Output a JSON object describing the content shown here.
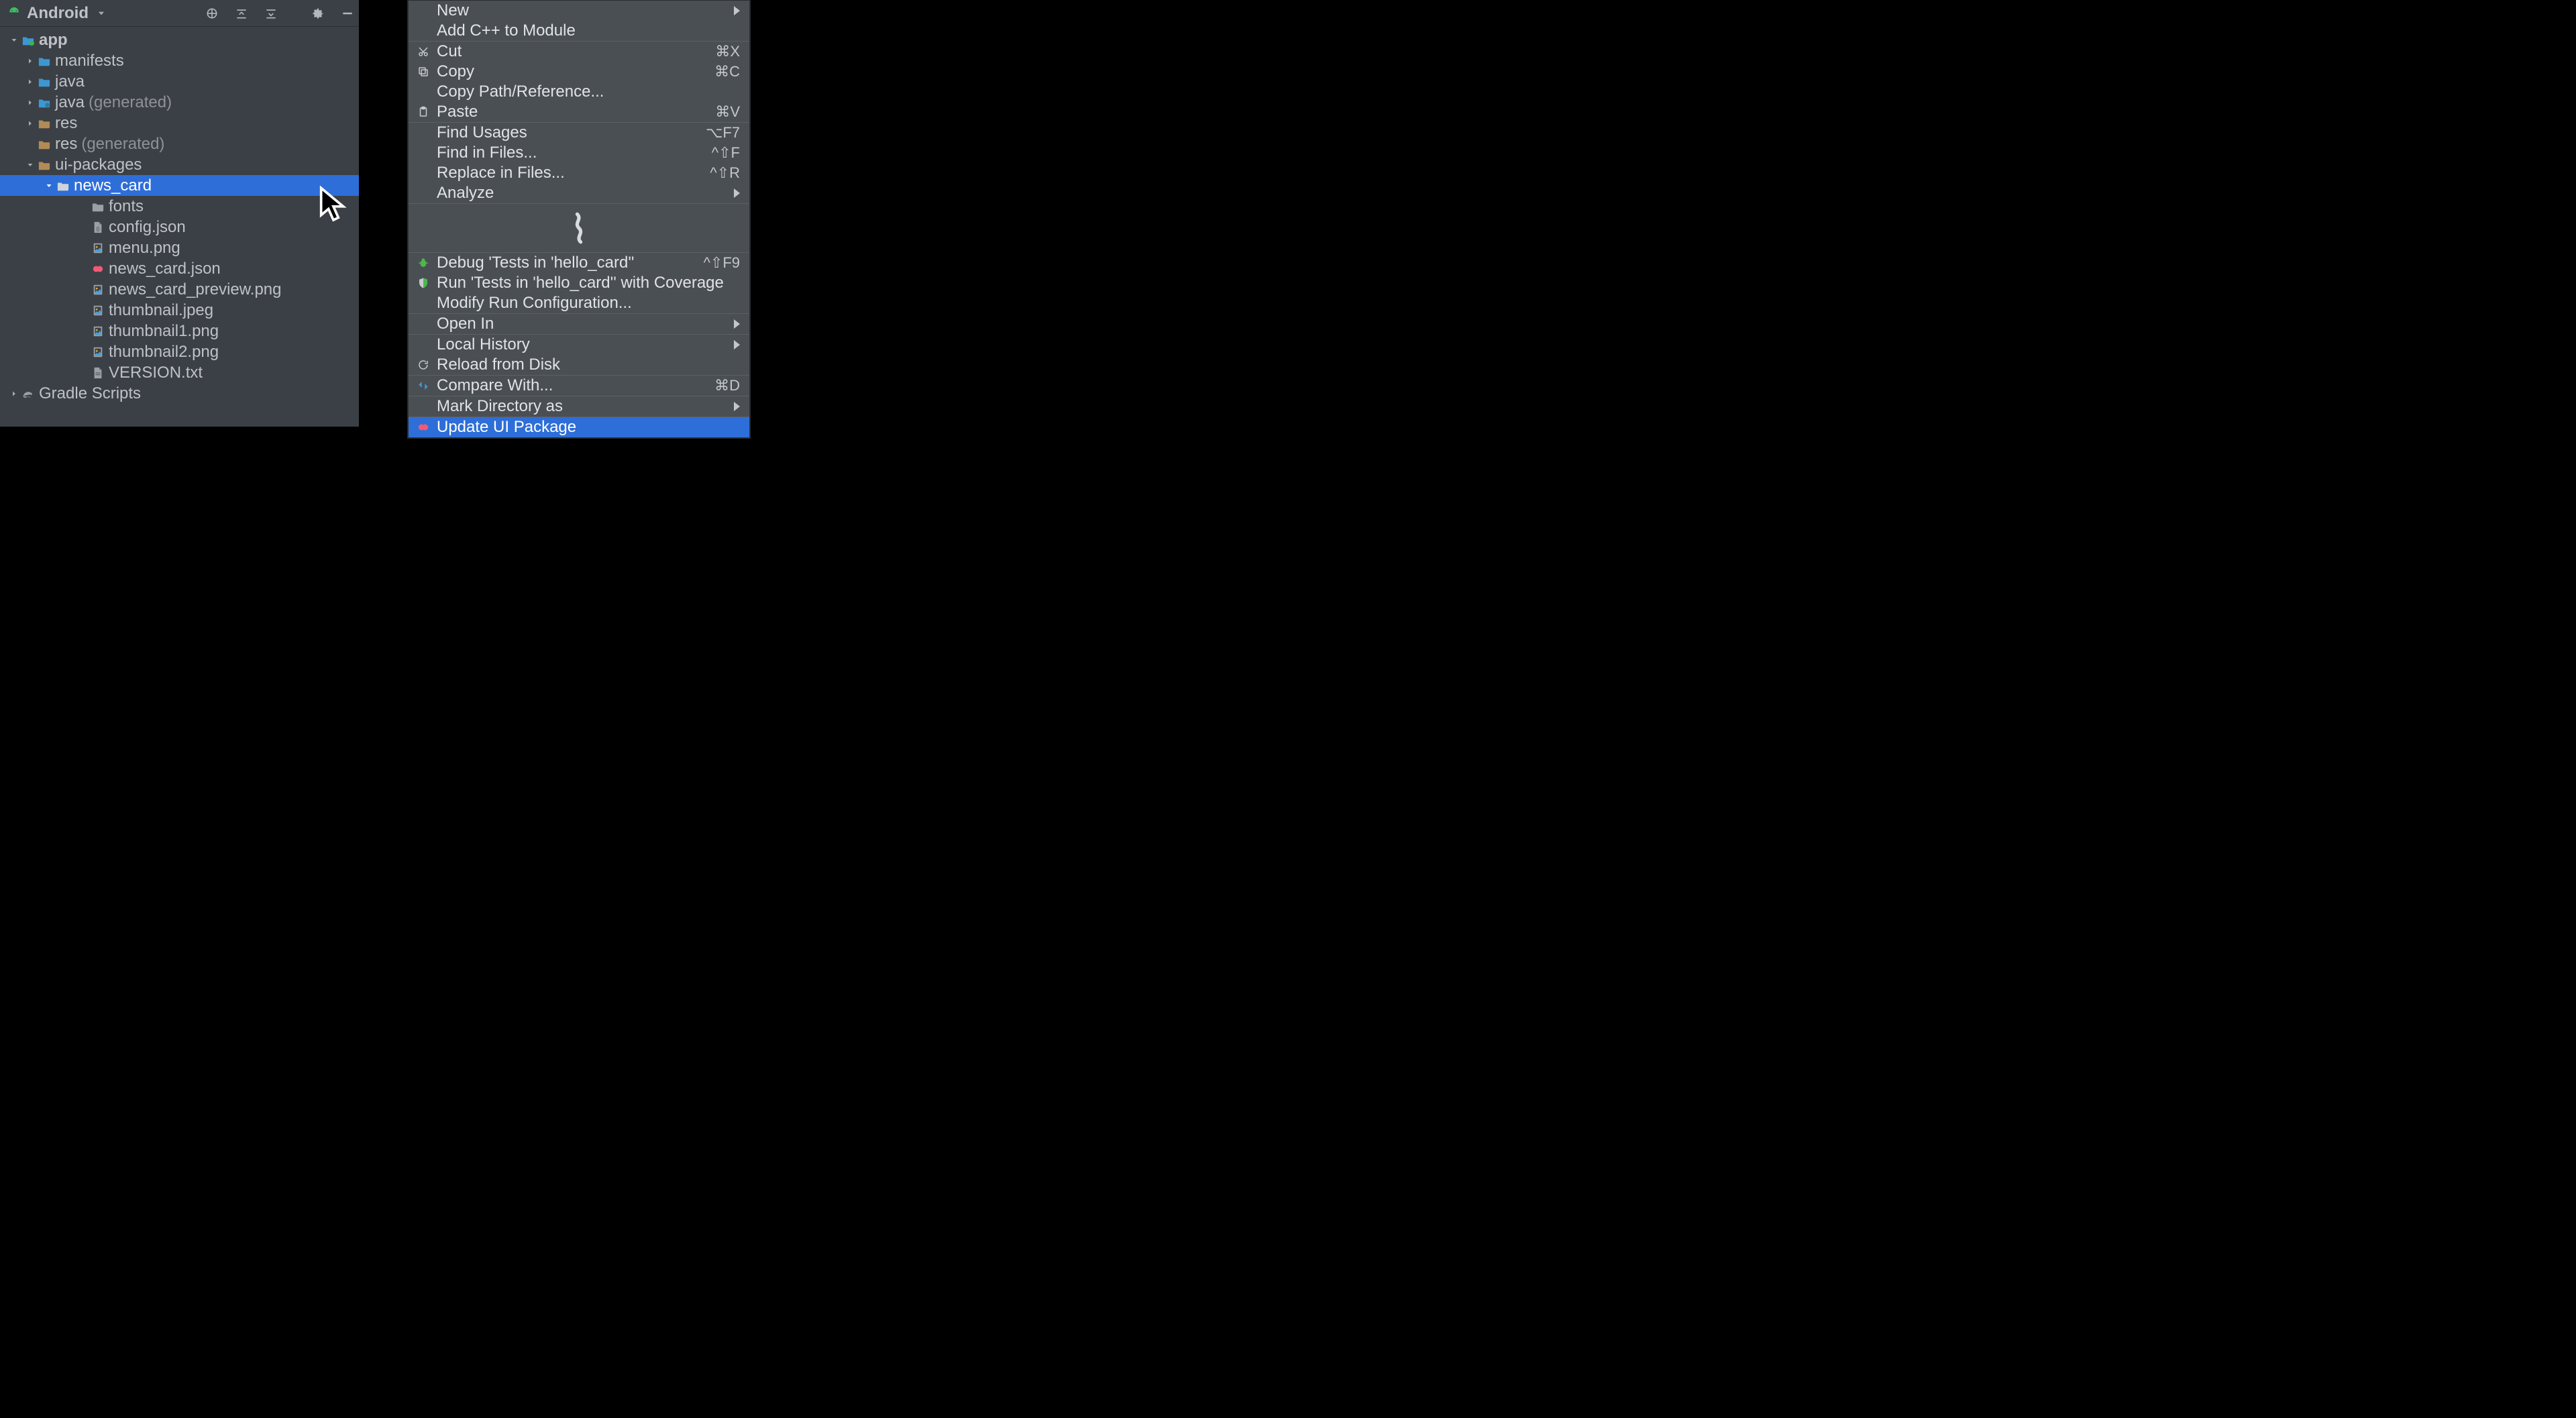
{
  "project": {
    "view_label": "Android",
    "tree": [
      {
        "id": "app",
        "label": "app",
        "kind": "module",
        "indent": 14,
        "caret": "down",
        "bold": true,
        "selected": false
      },
      {
        "id": "manifests",
        "label": "manifests",
        "kind": "folder",
        "indent": 38,
        "caret": "right",
        "bold": false,
        "selected": false
      },
      {
        "id": "java",
        "label": "java",
        "kind": "folder",
        "indent": 38,
        "caret": "right",
        "bold": false,
        "selected": false
      },
      {
        "id": "java-gen",
        "label": "java",
        "suffix": "(generated)",
        "kind": "folder-gen",
        "indent": 38,
        "caret": "right",
        "bold": false,
        "selected": false
      },
      {
        "id": "res",
        "label": "res",
        "kind": "folder-res",
        "indent": 38,
        "caret": "right",
        "bold": false,
        "selected": false
      },
      {
        "id": "res-gen",
        "label": "res",
        "suffix": "(generated)",
        "kind": "folder-res",
        "indent": 38,
        "caret": "blank",
        "bold": false,
        "selected": false
      },
      {
        "id": "ui-packages",
        "label": "ui-packages",
        "kind": "folder-res",
        "indent": 38,
        "caret": "down",
        "bold": false,
        "selected": false
      },
      {
        "id": "news_card",
        "label": "news_card",
        "kind": "folder-plain",
        "indent": 66,
        "caret": "down",
        "bold": false,
        "selected": true
      },
      {
        "id": "fonts",
        "label": "fonts",
        "kind": "folder-plain",
        "indent": 118,
        "caret": "blank",
        "bold": false,
        "selected": false
      },
      {
        "id": "config.json",
        "label": "config.json",
        "kind": "file-json",
        "indent": 118,
        "caret": "blank",
        "bold": false,
        "selected": false
      },
      {
        "id": "menu.png",
        "label": "menu.png",
        "kind": "file-image",
        "indent": 118,
        "caret": "blank",
        "bold": false,
        "selected": false
      },
      {
        "id": "news_card.json",
        "label": "news_card.json",
        "kind": "file-pink",
        "indent": 118,
        "caret": "blank",
        "bold": false,
        "selected": false
      },
      {
        "id": "newscard_prev",
        "label": "news_card_preview.png",
        "kind": "file-image",
        "indent": 118,
        "caret": "blank",
        "bold": false,
        "selected": false
      },
      {
        "id": "thumbnail.jpeg",
        "label": "thumbnail.jpeg",
        "kind": "file-image",
        "indent": 118,
        "caret": "blank",
        "bold": false,
        "selected": false
      },
      {
        "id": "thumbnail1.png",
        "label": "thumbnail1.png",
        "kind": "file-image",
        "indent": 118,
        "caret": "blank",
        "bold": false,
        "selected": false
      },
      {
        "id": "thumbnail2.png",
        "label": "thumbnail2.png",
        "kind": "file-image",
        "indent": 118,
        "caret": "blank",
        "bold": false,
        "selected": false
      },
      {
        "id": "VERSION.txt",
        "label": "VERSION.txt",
        "kind": "file-text",
        "indent": 118,
        "caret": "blank",
        "bold": false,
        "selected": false
      },
      {
        "id": "gradle",
        "label": "Gradle Scripts",
        "kind": "gradle",
        "indent": 14,
        "caret": "right",
        "bold": false,
        "selected": false
      }
    ]
  },
  "menu": {
    "items": [
      {
        "id": "new",
        "label": "New",
        "shortcut": "",
        "icon": "",
        "submenu": true,
        "highlight": false
      },
      {
        "id": "add-cpp",
        "label": "Add C++ to Module",
        "shortcut": "",
        "icon": "",
        "submenu": false,
        "highlight": false
      },
      {
        "sep": true
      },
      {
        "id": "cut",
        "label": "Cut",
        "shortcut": "⌘X",
        "icon": "cut",
        "submenu": false,
        "highlight": false
      },
      {
        "id": "copy",
        "label": "Copy",
        "shortcut": "⌘C",
        "icon": "copy",
        "submenu": false,
        "highlight": false
      },
      {
        "id": "copy-path",
        "label": "Copy Path/Reference...",
        "shortcut": "",
        "icon": "",
        "submenu": false,
        "highlight": false
      },
      {
        "id": "paste",
        "label": "Paste",
        "shortcut": "⌘V",
        "icon": "paste",
        "submenu": false,
        "highlight": false
      },
      {
        "sep": true
      },
      {
        "id": "find-usages",
        "label": "Find Usages",
        "shortcut": "⌥F7",
        "icon": "",
        "submenu": false,
        "highlight": false
      },
      {
        "id": "find-in-files",
        "label": "Find in Files...",
        "shortcut": "^⇧F",
        "icon": "",
        "submenu": false,
        "highlight": false
      },
      {
        "id": "replace-in-files",
        "label": "Replace in Files...",
        "shortcut": "^⇧R",
        "icon": "",
        "submenu": false,
        "highlight": false
      },
      {
        "id": "analyze",
        "label": "Analyze",
        "shortcut": "",
        "icon": "",
        "submenu": true,
        "highlight": false
      },
      {
        "sep": true
      },
      {
        "squiggle": true
      },
      {
        "sep": true
      },
      {
        "id": "debug-tests",
        "label": "Debug 'Tests in 'hello_card''",
        "shortcut": "^⇧F9",
        "icon": "bug",
        "submenu": false,
        "highlight": false
      },
      {
        "id": "run-coverage",
        "label": "Run 'Tests in 'hello_card'' with Coverage",
        "shortcut": "",
        "icon": "shield",
        "submenu": false,
        "highlight": false
      },
      {
        "id": "modify-run",
        "label": "Modify Run Configuration...",
        "shortcut": "",
        "icon": "",
        "submenu": false,
        "highlight": false
      },
      {
        "sep": true
      },
      {
        "id": "open-in",
        "label": "Open In",
        "shortcut": "",
        "icon": "",
        "submenu": true,
        "highlight": false
      },
      {
        "sep": true
      },
      {
        "id": "local-history",
        "label": "Local History",
        "shortcut": "",
        "icon": "",
        "submenu": true,
        "highlight": false
      },
      {
        "id": "reload-disk",
        "label": "Reload from Disk",
        "shortcut": "",
        "icon": "reload",
        "submenu": false,
        "highlight": false
      },
      {
        "sep": true
      },
      {
        "id": "compare-with",
        "label": "Compare With...",
        "shortcut": "⌘D",
        "icon": "compare",
        "submenu": false,
        "highlight": false
      },
      {
        "sep": true
      },
      {
        "id": "mark-dir",
        "label": "Mark Directory as",
        "shortcut": "",
        "icon": "",
        "submenu": true,
        "highlight": false
      },
      {
        "sep": true
      },
      {
        "id": "update-ui-pkg",
        "label": "Update UI Package",
        "shortcut": "",
        "icon": "pink",
        "submenu": false,
        "highlight": true
      }
    ]
  }
}
